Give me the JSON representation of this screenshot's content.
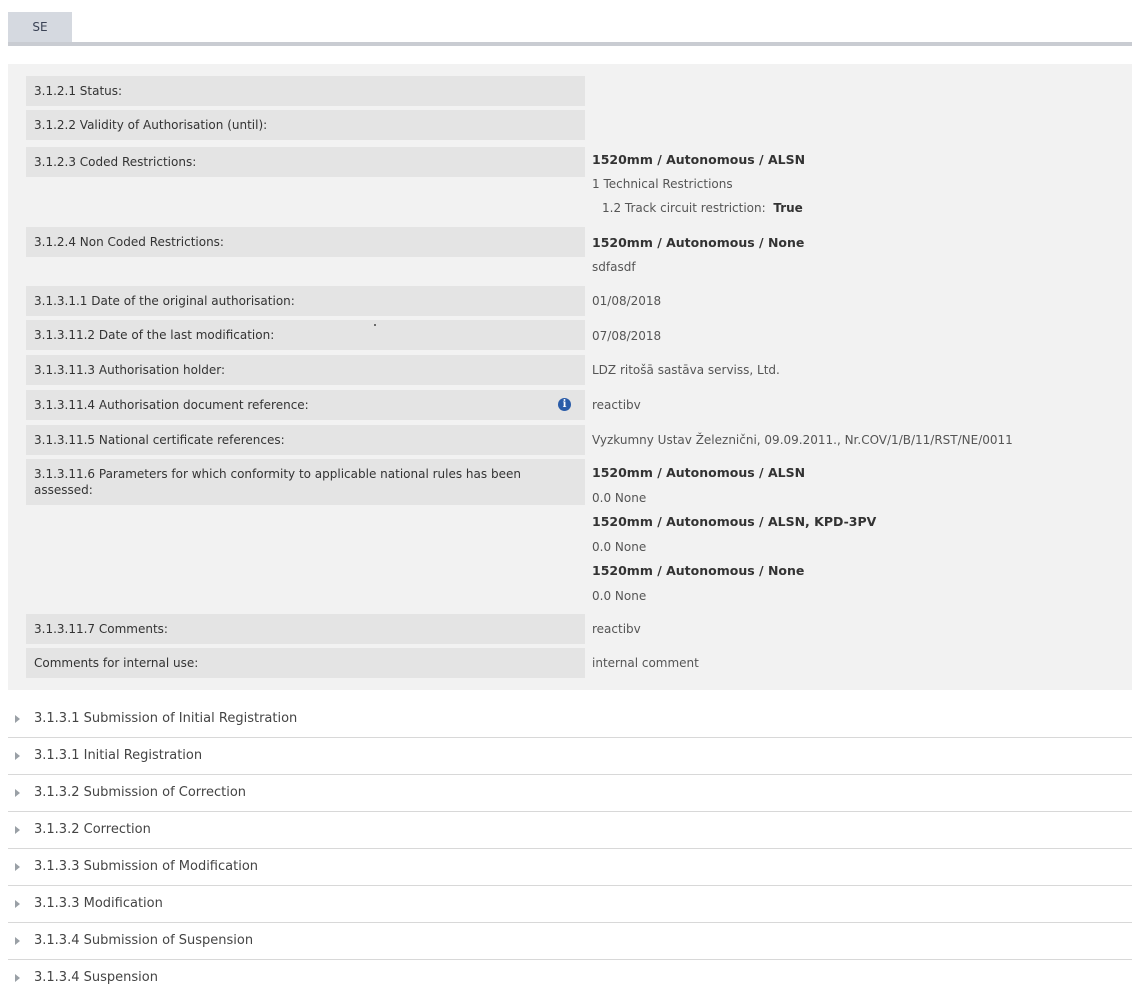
{
  "tab": {
    "label": "SE"
  },
  "rows": [
    {
      "label": "3.1.2.1 Status:"
    },
    {
      "label": "3.1.2.2 Validity of Authorisation (until):"
    },
    {
      "label": "3.1.2.3 Coded Restrictions:",
      "values": [
        "1520mm / Autonomous / ALSN",
        "1 Technical Restrictions"
      ],
      "sub": {
        "text": "1.2 Track circuit restriction:",
        "bold": "True"
      }
    },
    {
      "label": "3.1.2.4 Non Coded Restrictions:",
      "values": [
        "1520mm / Autonomous / None",
        "sdfasdf"
      ]
    },
    {
      "label": "3.1.3.1.1 Date of the original authorisation:",
      "values": [
        "01/08/2018"
      ]
    },
    {
      "label": "3.1.3.11.2 Date of the last modification:",
      "values": [
        "07/08/2018"
      ]
    },
    {
      "label": "3.1.3.11.3 Authorisation holder:",
      "values": [
        "LDZ ritošā sastāva serviss, Ltd."
      ]
    },
    {
      "label": "3.1.3.11.4 Authorisation document reference:",
      "values": [
        "reactibv"
      ],
      "icon": "info-icon"
    },
    {
      "label": "3.1.3.11.5 National certificate references:",
      "values": [
        "Vyzkumny Ustav Železnični, 09.09.2011., Nr.COV/1/B/11/RST/NE/0011"
      ]
    },
    {
      "label": "3.1.3.11.6 Parameters for which conformity to applicable national rules has been assessed:",
      "values": [
        "1520mm / Autonomous / ALSN",
        "0.0 None",
        "1520mm / Autonomous / ALSN, KPD-3PV",
        "0.0 None",
        "1520mm / Autonomous / None",
        "0.0 None"
      ]
    },
    {
      "label": "3.1.3.11.7 Comments:",
      "values": [
        "reactibv"
      ]
    },
    {
      "label": "Comments for internal use:",
      "values": [
        "internal comment"
      ]
    }
  ],
  "accordion": [
    {
      "title": "3.1.3.1 Submission of Initial Registration"
    },
    {
      "title": "3.1.3.1 Initial Registration"
    },
    {
      "title": "3.1.3.2 Submission of Correction"
    },
    {
      "title": "3.1.3.2 Correction"
    },
    {
      "title": "3.1.3.3 Submission of Modification"
    },
    {
      "title": "3.1.3.3 Modification"
    },
    {
      "title": "3.1.3.4 Submission of Suspension"
    },
    {
      "title": "3.1.3.4 Suspension"
    }
  ],
  "colors": {
    "panel": "#f2f2f2",
    "label_bg": "#e4e4e4",
    "tab_bg": "#d5d9e0",
    "info_icon": "#2a5ca8"
  }
}
